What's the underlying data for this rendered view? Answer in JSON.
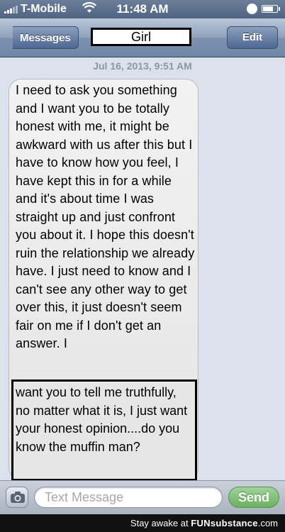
{
  "status_bar": {
    "carrier": "T-Mobile",
    "time": "11:48 AM",
    "battery_level": 0.8
  },
  "nav": {
    "back_label": "Messages",
    "title": "Girl",
    "edit_label": "Edit"
  },
  "conversation": {
    "timestamp": "Jul 16, 2013, 9:51 AM",
    "message_main": "I need to ask you something and I want you to be totally honest with me, it might be awkward with us after this but I have to know how you feel, I have kept this in for a while and it's about time I was straight up and just confront you about it. I hope this doesn't ruin the relationship we already have. I just need to know and I can't see any other way to get over this, it just doesn't seem fair on me if I don't get an answer. I",
    "message_highlight": "want you to tell me truthfully, no matter what it is, I just want your honest opinion....do you know the muffin man?"
  },
  "composer": {
    "placeholder": "Text Message",
    "send_label": "Send"
  },
  "watermark": {
    "prefix": "Stay awake at",
    "brand": "FUNsubstance",
    "suffix": ".com"
  },
  "colors": {
    "nav_blue": "#6f86a6",
    "send_green": "#6bb15f",
    "bubble_gray": "#e6e6e6"
  },
  "icons": [
    "signal-bars-icon",
    "wifi-icon",
    "rotation-lock-icon",
    "battery-icon",
    "back-arrow-icon",
    "camera-icon"
  ]
}
